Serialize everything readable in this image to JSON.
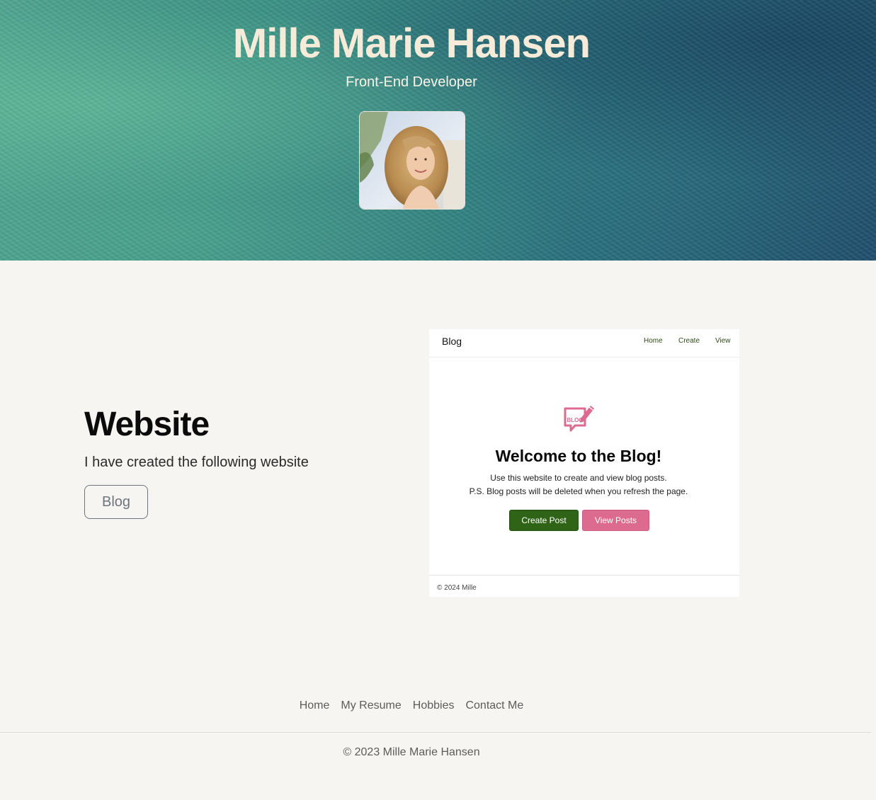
{
  "header": {
    "name": "Mille Marie Hansen",
    "subtitle": "Front-End Developer",
    "profile_image": "profile-photo",
    "text_color": "#f6ead8"
  },
  "project": {
    "heading": "Website",
    "description": "I have created the following website",
    "button_label": "Blog"
  },
  "preview": {
    "brand": "Blog",
    "nav_links": [
      "Home",
      "Create",
      "View"
    ],
    "icon": "blog-chat-pencil-icon",
    "icon_text": "BLOG",
    "title": "Welcome to the Blog!",
    "line1": "Use this website to create and view blog posts.",
    "line2": "P.S. Blog posts will be deleted when you refresh the page.",
    "create_label": "Create Post",
    "view_label": "View Posts",
    "footer": "© 2024 Mille",
    "accent_green": "#2f6417",
    "accent_pink": "#dc6b8f"
  },
  "footer": {
    "links": [
      "Home",
      "My Resume",
      "Hobbies",
      "Contact Me"
    ],
    "copyright": "© 2023 Mille Marie Hansen"
  }
}
